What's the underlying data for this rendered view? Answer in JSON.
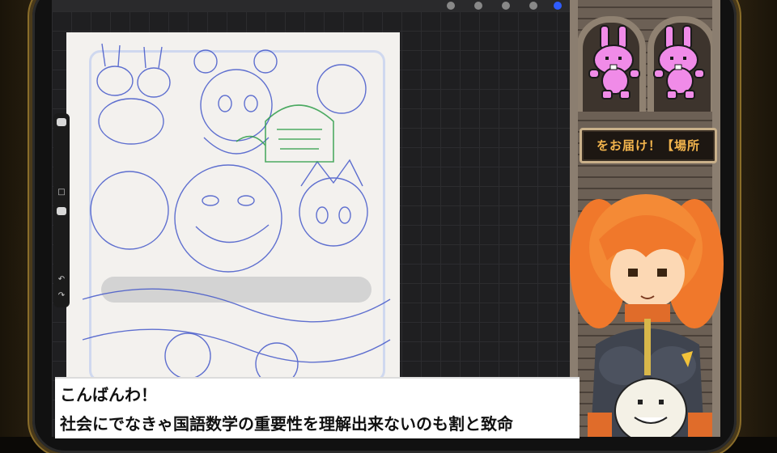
{
  "app": {
    "name": "drawing-app-stream-overlay"
  },
  "toolbar": {
    "icons": [
      "brush-icon",
      "smudge-icon",
      "eraser-icon",
      "layers-icon",
      "color-icon"
    ],
    "accent_color": "#2f5cff"
  },
  "sidebar": {
    "icons": [
      "brush-size-slider",
      "opacity-slider",
      "modify-square-icon",
      "undo-icon",
      "redo-icon"
    ],
    "undo_glyph": "↶",
    "redo_glyph": "↷",
    "square_glyph": "□"
  },
  "canvas": {
    "paper_color": "#f3f1ee",
    "sketch_color": "#3a4fc8",
    "sketch_green": "#2f9e4a"
  },
  "overlay": {
    "sign_text": "をお届け！【場所",
    "sign_color": "#f3b54d",
    "rabbit_color": "#f08be8"
  },
  "dialog": {
    "line1": "こんばんわ！",
    "line2": "社会にでなきゃ国語数学の重要性を理解出来ないのも割と致命"
  }
}
